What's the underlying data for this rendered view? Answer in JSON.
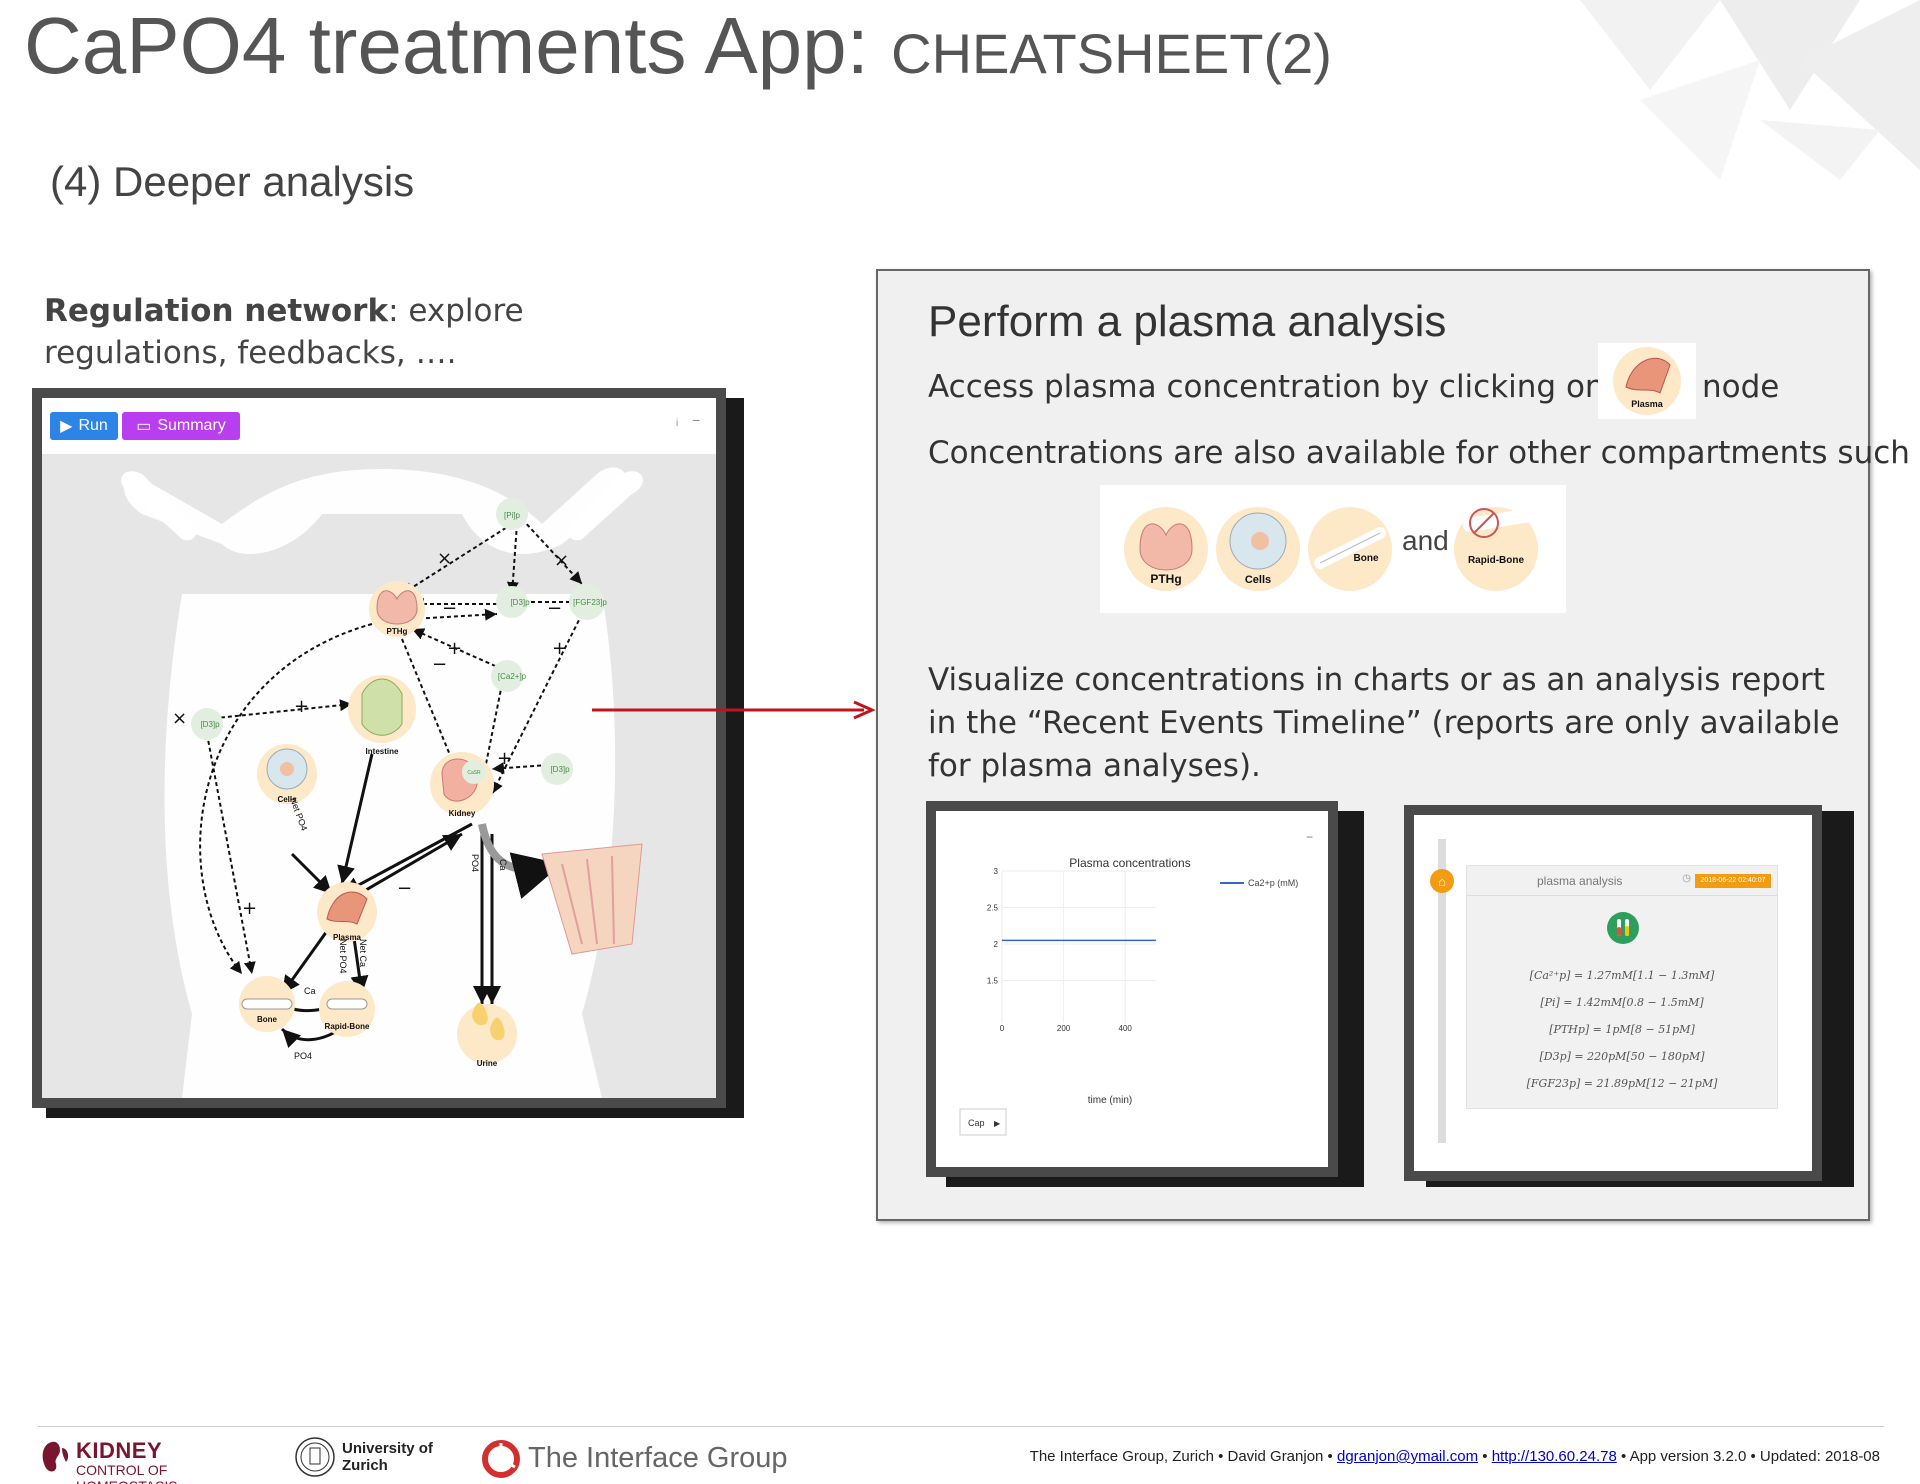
{
  "header": {
    "title": "CaPO4 treatments App:",
    "subtitle": "CHEATSHEET(2)",
    "section": "(4) Deeper analysis"
  },
  "left": {
    "bold": "Regulation network",
    "text": ": explore regulations, feedbacks, …."
  },
  "network_window": {
    "run_label": "Run",
    "summary_label": "Summary",
    "nodes": [
      "[Pi]p",
      "PTHg",
      "[D3]p",
      "[FGF23]p",
      "[Ca2+]p",
      "[D3]p",
      "Intestine",
      "Cells",
      "Kidney",
      "CaSR",
      "[D3]p",
      "Plasma",
      "Bone",
      "Rapid-Bone",
      "Urine"
    ],
    "edge_labels": [
      "Net PO4",
      "Net PO4",
      "Net Ca",
      "Ca",
      "PO4",
      "PO4",
      "Ca"
    ]
  },
  "panel": {
    "title": "Perform a plasma analysis",
    "line1": "Access plasma concentration by clicking on the",
    "line1_end": "node",
    "plasma_node_label": "Plasma",
    "line2": "Concentrations are also available for other compartments such as",
    "compartments": [
      "PTHg",
      "Cells",
      "Bone",
      "Rapid-Bone"
    ],
    "and": "and",
    "line3": "Visualize concentrations in charts or as an analysis report in the “Recent Events Timeline” (reports are only available for plasma analyses)."
  },
  "chart_data": {
    "type": "line",
    "title": "Plasma concentrations",
    "xlabel": "time (min)",
    "ylabel": "",
    "xlim": [
      0,
      500
    ],
    "ylim": [
      1,
      3
    ],
    "xticks": [
      "0",
      "200",
      "400"
    ],
    "yticks": [
      "1.5",
      "2",
      "2.5",
      "3"
    ],
    "series": [
      {
        "name": "Ca2+p (mM)",
        "x": [
          0,
          500
        ],
        "values": [
          2.05,
          2.05
        ],
        "color": "#3366cc"
      }
    ],
    "select_label": "Cap"
  },
  "report": {
    "title": "plasma analysis",
    "date": "2018-06-22 02:40:07",
    "lines": [
      "[Ca²⁺p] = 1.27mM[1.1 − 1.3mM]",
      "[Pi] = 1.42mM[0.8 − 1.5mM]",
      "[PTHp] = 1pM[8 − 51pM]",
      "[D3p] = 220pM[50 − 180pM]",
      "[FGF23p] = 21.89pM[12 − 21pM]"
    ]
  },
  "footer": {
    "kidney1": "KIDNEY",
    "kidney2": "CONTROL OF HOMEOSTASIS",
    "uzh1": "University of",
    "uzh2": "Zurich",
    "ig": "The Interface Group",
    "info1": "The Interface Group, Zurich • David Granjon • ",
    "email": "dgranjon@ymail.com",
    "sep1": " • ",
    "url": "http://130.60.24.78",
    "info2": " •  App version  3.2.0 •  Updated: 2018-08"
  },
  "colors": {
    "run": "#2b84e6",
    "summary": "#b93ef0",
    "arrow": "#c0141c",
    "series": "#3366cc",
    "kidney": "#7a1530"
  }
}
